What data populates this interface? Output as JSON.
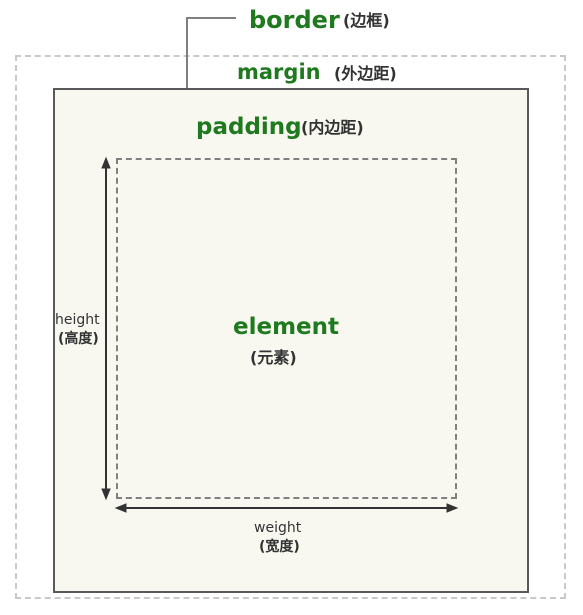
{
  "labels": {
    "border": "border",
    "border_cn": "(边框)",
    "margin": "margin",
    "margin_cn": "(外边距)",
    "padding": "padding",
    "padding_cn": "(内边距)",
    "element": "element",
    "element_cn": "(元素)",
    "height": "height",
    "height_cn": "(高度)",
    "width": "weight",
    "width_cn": "(宽度)"
  },
  "colors": {
    "label_green": "#1f7a1f",
    "label_dark": "#333333",
    "border_fill": "#f8f8f1",
    "border_line": "#595959",
    "margin_dash": "#c9c9c9",
    "element_dash": "#808080",
    "arrow": "#333333"
  }
}
